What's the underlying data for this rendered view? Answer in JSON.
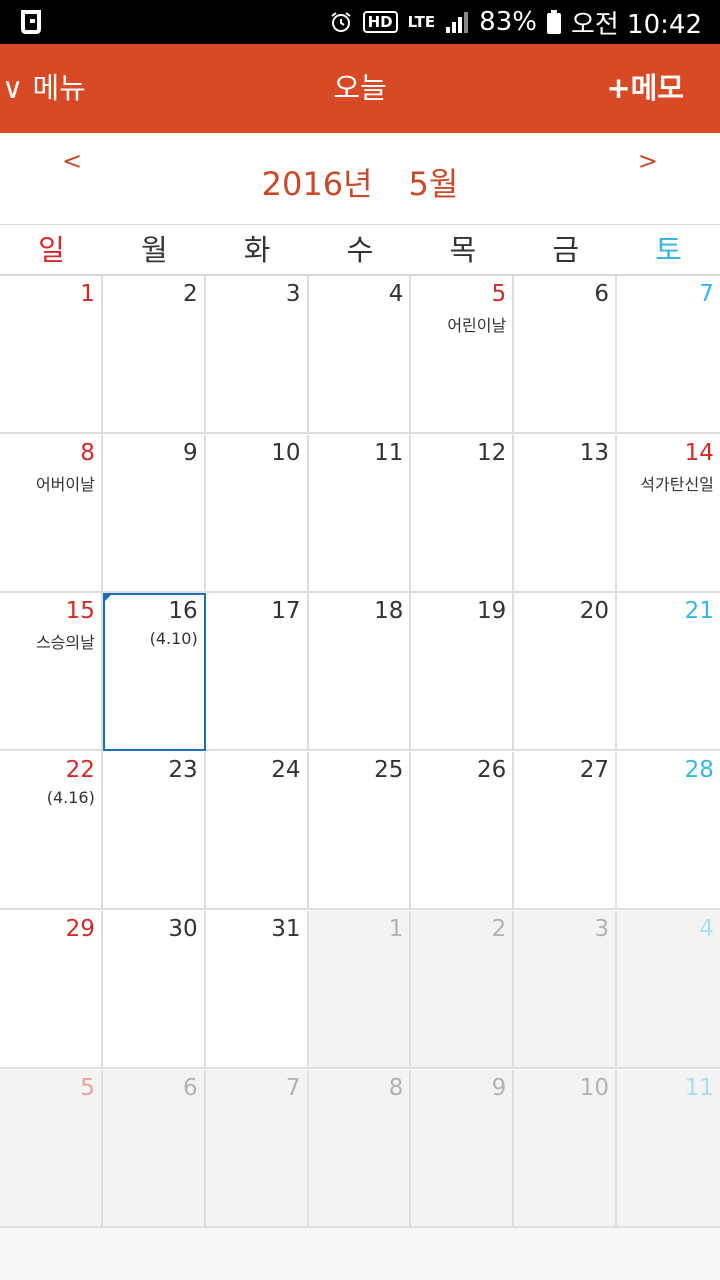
{
  "status_bar": {
    "hd": "HD",
    "network": "LTE",
    "battery": "83%",
    "time": "오전 10:42"
  },
  "header": {
    "menu": "∨ 메뉴",
    "today": "오늘",
    "memo": "+메모",
    "color": "#d84a26"
  },
  "month_nav": {
    "prev": "<",
    "next": ">",
    "year": "2016년",
    "month": "5월"
  },
  "weekdays": [
    "일",
    "월",
    "화",
    "수",
    "목",
    "금",
    "토"
  ],
  "weeks": [
    [
      {
        "day": "1"
      },
      {
        "day": "2"
      },
      {
        "day": "3"
      },
      {
        "day": "4"
      },
      {
        "day": "5",
        "note": "어린이날",
        "holiday": true
      },
      {
        "day": "6"
      },
      {
        "day": "7"
      }
    ],
    [
      {
        "day": "8",
        "note": "어버이날"
      },
      {
        "day": "9"
      },
      {
        "day": "10"
      },
      {
        "day": "11"
      },
      {
        "day": "12"
      },
      {
        "day": "13"
      },
      {
        "day": "14",
        "note": "석가탄신일",
        "holiday": true
      }
    ],
    [
      {
        "day": "15",
        "note": "스승의날"
      },
      {
        "day": "16",
        "note": "(4.10)",
        "selected": true
      },
      {
        "day": "17"
      },
      {
        "day": "18"
      },
      {
        "day": "19"
      },
      {
        "day": "20"
      },
      {
        "day": "21"
      }
    ],
    [
      {
        "day": "22",
        "note": "(4.16)"
      },
      {
        "day": "23"
      },
      {
        "day": "24"
      },
      {
        "day": "25"
      },
      {
        "day": "26"
      },
      {
        "day": "27"
      },
      {
        "day": "28"
      }
    ],
    [
      {
        "day": "29"
      },
      {
        "day": "30"
      },
      {
        "day": "31"
      },
      {
        "day": "1",
        "out": true
      },
      {
        "day": "2",
        "out": true
      },
      {
        "day": "3",
        "out": true
      },
      {
        "day": "4",
        "out": true
      }
    ],
    [
      {
        "day": "5",
        "out": true
      },
      {
        "day": "6",
        "out": true
      },
      {
        "day": "7",
        "out": true
      },
      {
        "day": "8",
        "out": true
      },
      {
        "day": "9",
        "out": true
      },
      {
        "day": "10",
        "out": true
      },
      {
        "day": "11",
        "out": true
      }
    ]
  ]
}
